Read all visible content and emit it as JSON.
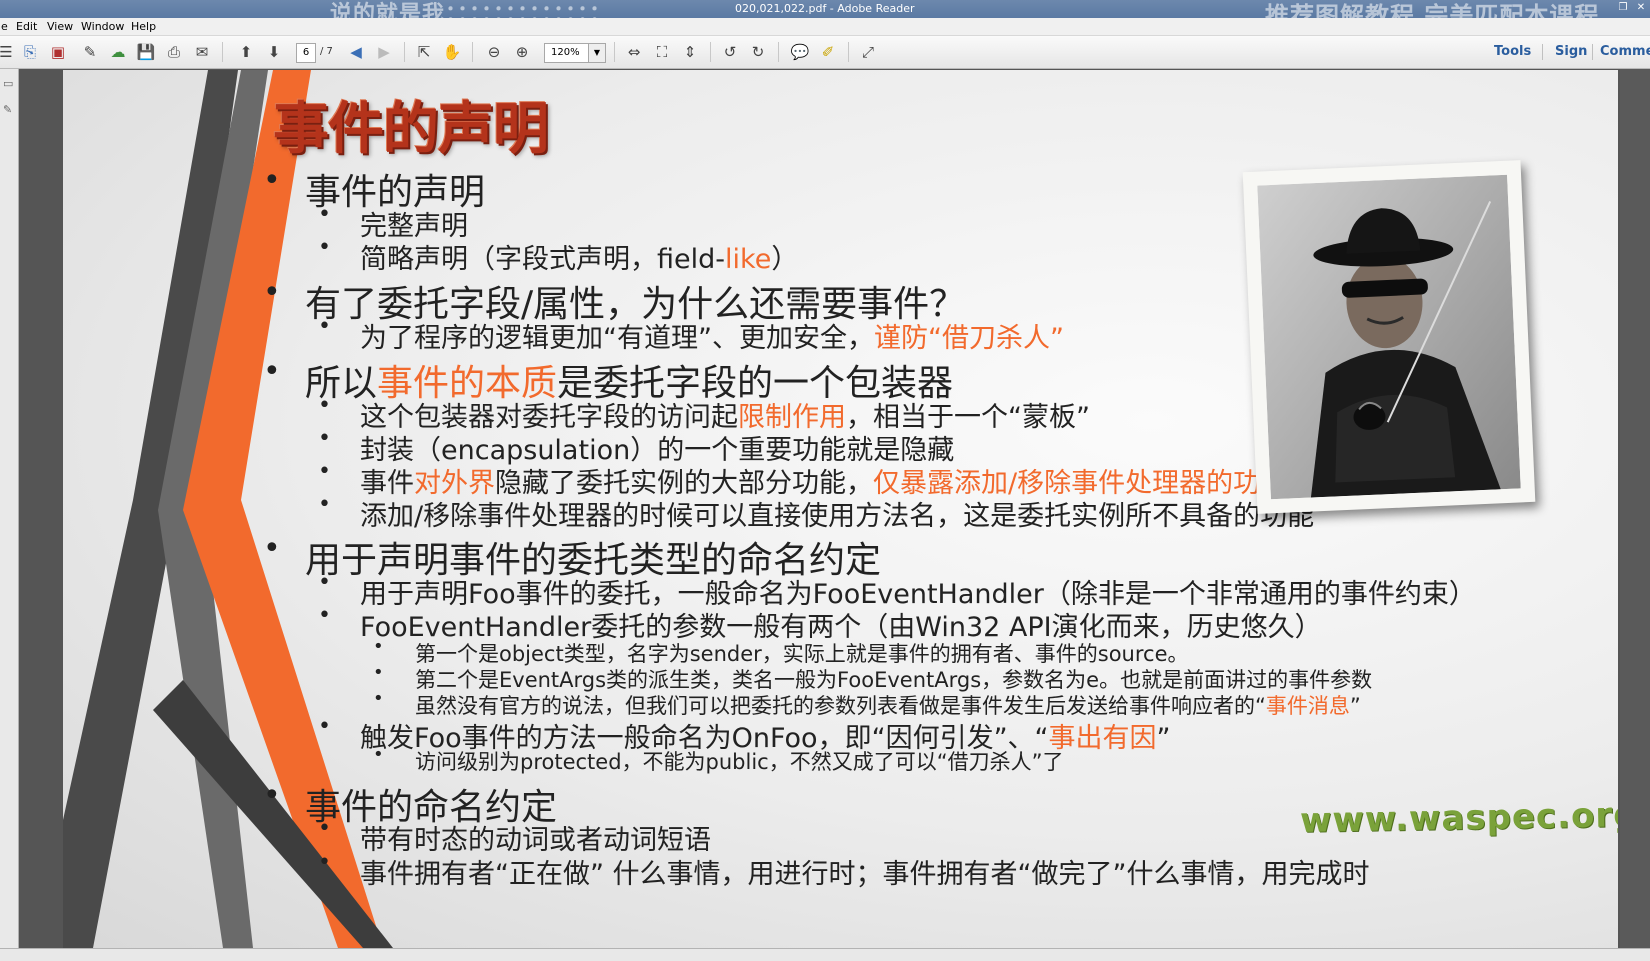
{
  "window": {
    "title": "020,021,022.pdf - Adobe Reader",
    "overlay_left": "说的就是我：：：：：：：：：：：：：",
    "overlay_right": "推荐图解教程  完美匹配本课程",
    "restore_glyph": "❐",
    "close_glyph": "✕"
  },
  "menu": {
    "items": [
      "e",
      "Edit",
      "View",
      "Window",
      "Help"
    ]
  },
  "toolbar": {
    "page_current": "6",
    "page_total": "/ 7",
    "zoom": "120%",
    "tools_label": "Tools",
    "sign_label": "Sign",
    "comment_label": "Comme"
  },
  "slide": {
    "title": "事件的声明",
    "bullets": [
      {
        "level": 1,
        "parts": [
          {
            "t": "事件的声明"
          }
        ]
      },
      {
        "level": 2,
        "parts": [
          {
            "t": "完整声明"
          }
        ]
      },
      {
        "level": 2,
        "parts": [
          {
            "t": "简略声明（字段式声明，field-"
          },
          {
            "t": "like",
            "hl": true
          },
          {
            "t": "）"
          }
        ]
      },
      {
        "level": 1,
        "parts": [
          {
            "t": "有了委托字段/属性，为什么还需要事件？"
          }
        ]
      },
      {
        "level": 2,
        "parts": [
          {
            "t": "为了程序的逻辑更加“有道理”、更加安全，"
          },
          {
            "t": "谨防“借刀杀人”",
            "hl": true
          }
        ]
      },
      {
        "level": 1,
        "parts": [
          {
            "t": "所以"
          },
          {
            "t": "事件的本质",
            "hl": true
          },
          {
            "t": "是委托字段的一个包装器"
          }
        ]
      },
      {
        "level": 2,
        "parts": [
          {
            "t": "这个包装器对委托字段的访问起"
          },
          {
            "t": "限制作用",
            "hl": true
          },
          {
            "t": "，相当于一个“蒙板”"
          }
        ]
      },
      {
        "level": 2,
        "parts": [
          {
            "t": "封装（encapsulation）的一个重要功能就是隐藏"
          }
        ]
      },
      {
        "level": 2,
        "parts": [
          {
            "t": "事件"
          },
          {
            "t": "对外界",
            "hl": true
          },
          {
            "t": "隐藏了委托实例的大部分功能，"
          },
          {
            "t": "仅暴露添加/移除事件处理器的功能",
            "hl": true
          }
        ]
      },
      {
        "level": 2,
        "parts": [
          {
            "t": "添加/移除事件处理器的时候可以直接使用方法名，这是委托实例所不具备的功能"
          }
        ]
      },
      {
        "level": 1,
        "parts": [
          {
            "t": "用于声明事件的委托类型的命名约定"
          }
        ]
      },
      {
        "level": 2,
        "parts": [
          {
            "t": "用于声明Foo事件的委托，一般命名为FooEventHandler（除非是一个非常通用的事件约束）"
          }
        ]
      },
      {
        "level": 2,
        "parts": [
          {
            "t": "FooEventHandler委托的参数一般有两个（由Win32 API演化而来，历史悠久）"
          }
        ]
      },
      {
        "level": 3,
        "parts": [
          {
            "t": "第一个是object类型，名字为sender，实际上就是事件的拥有者、事件的source。"
          }
        ]
      },
      {
        "level": 3,
        "parts": [
          {
            "t": "第二个是EventArgs类的派生类，类名一般为FooEventArgs，参数名为e。也就是前面讲过的事件参数"
          }
        ]
      },
      {
        "level": 3,
        "parts": [
          {
            "t": "虽然没有官方的说法，但我们可以把委托的参数列表看做是事件发生后发送给事件响应者的“"
          },
          {
            "t": "事件消息",
            "hl": true
          },
          {
            "t": "”"
          }
        ]
      },
      {
        "level": 2,
        "parts": [
          {
            "t": "触发Foo事件的方法一般命名为OnFoo，即“因何引发”、“"
          },
          {
            "t": "事出有因",
            "hl": true
          },
          {
            "t": "”"
          }
        ]
      },
      {
        "level": 3,
        "parts": [
          {
            "t": "访问级别为protected，不能为public，不然又成了可以“借刀杀人”了"
          }
        ]
      },
      {
        "level": 1,
        "parts": [
          {
            "t": "事件的命名约定"
          }
        ]
      },
      {
        "level": 2,
        "parts": [
          {
            "t": "带有时态的动词或者动词短语"
          }
        ]
      },
      {
        "level": 2,
        "parts": [
          {
            "t": "事件拥有者“正在做” 什么事情，用进行时；事件拥有者“做完了”什么事情，用完成时"
          }
        ]
      }
    ],
    "watermark": "www.waspec.org",
    "bullet_glyph_l1": "•",
    "bullet_glyph_l2": "•",
    "bullet_glyph_l3": "•"
  },
  "colors": {
    "highlight": "#f26a2d",
    "title": "#b4331b",
    "watermark": "#7aa23a"
  }
}
